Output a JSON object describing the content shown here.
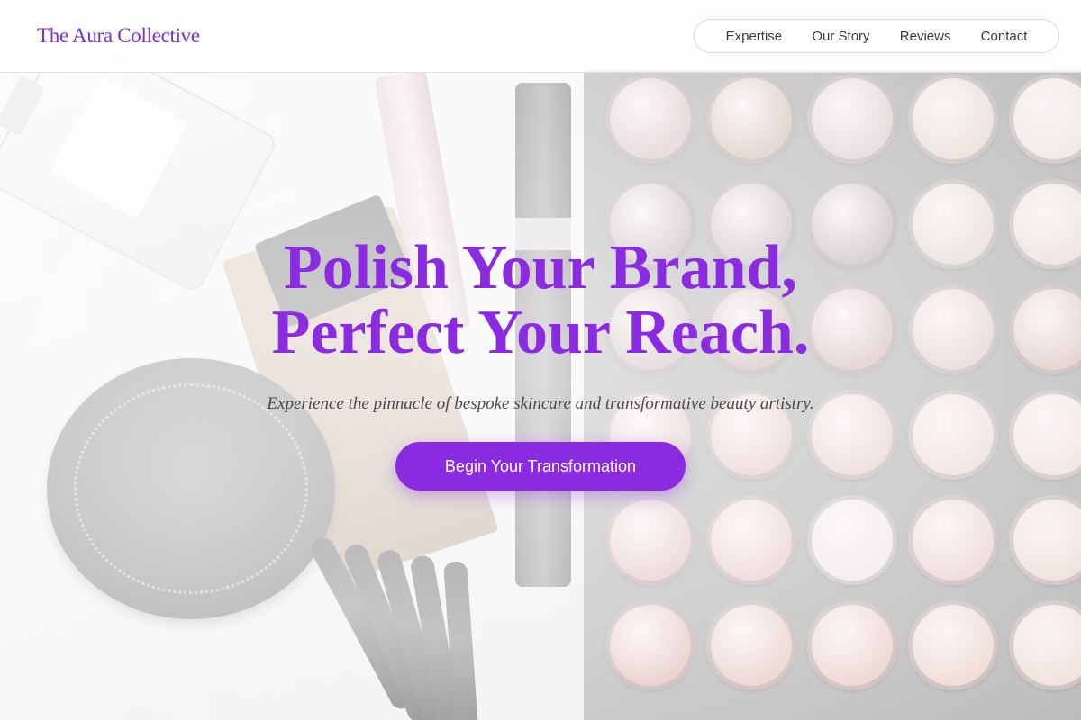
{
  "brand": {
    "name": "The Aura Collective",
    "accent_color": "#8a2be2"
  },
  "nav": {
    "items": [
      {
        "label": "Expertise"
      },
      {
        "label": "Our Story"
      },
      {
        "label": "Reviews"
      },
      {
        "label": "Contact"
      }
    ]
  },
  "hero": {
    "headline_line1": "Polish Your Brand,",
    "headline_line2": "Perfect Your Reach.",
    "subheading": "Experience the pinnacle of bespoke skincare and transformative beauty artistry.",
    "cta_label": "Begin Your Transformation"
  },
  "background": {
    "description_icon": "makeup-flatlay-image",
    "swatch_colors": [
      "#c9b1b2",
      "#c1ab9c",
      "#cbc2bf",
      "#dccfc4",
      "#e6dcd6",
      "#a8989f",
      "#ab9ea3",
      "#a9999d",
      "#d8cbc4",
      "#e0d3cc",
      "#b8a0a3",
      "#b49798",
      "#c4a1a3",
      "#d6bdb7",
      "#cfb1a9",
      "#cfadac",
      "#d8b4b0",
      "#ddbdb5",
      "#e4ccc3",
      "#e8d6cd",
      "#d5aeab",
      "#dcb8b2",
      "#e8dfe1",
      "#e2c2bc",
      "#e6cfc6",
      "#d8aaa5",
      "#deb6af",
      "#e2bcb4",
      "#e6c7be",
      "#e9d1c8"
    ]
  }
}
